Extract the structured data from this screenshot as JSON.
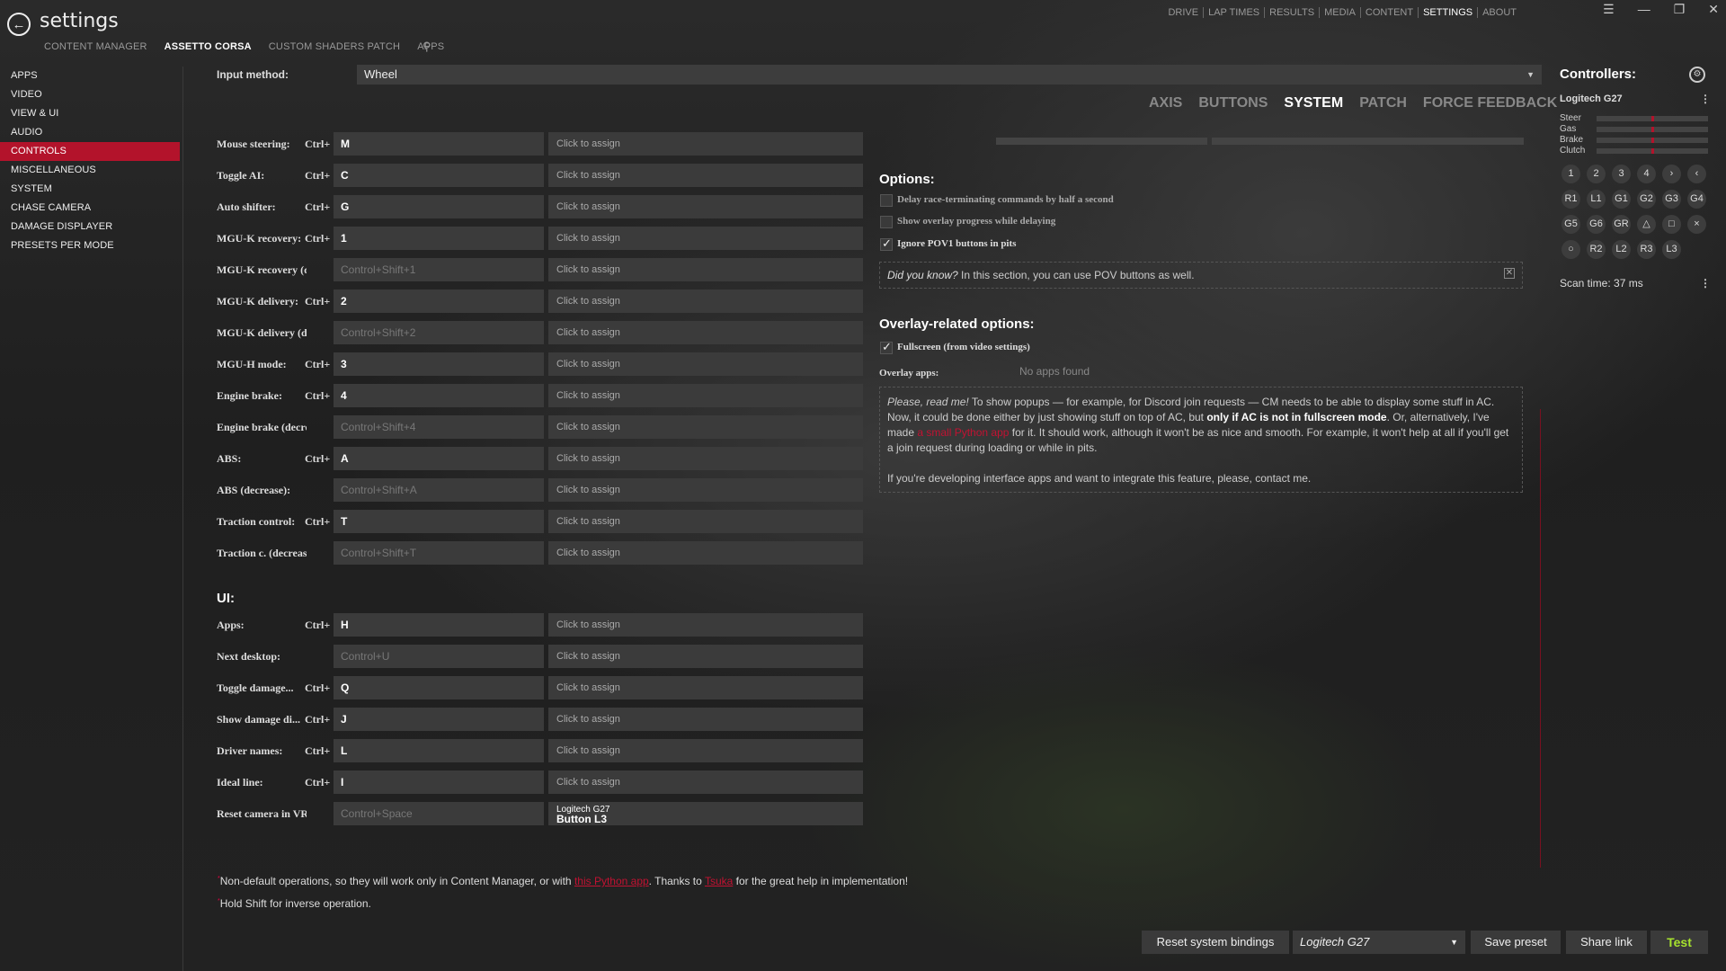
{
  "header": {
    "title": "settings",
    "subtabs": [
      "CONTENT MANAGER",
      "ASSETTO CORSA",
      "CUSTOM SHADERS PATCH",
      "APPS"
    ],
    "main_nav": [
      "DRIVE",
      "LAP TIMES",
      "RESULTS",
      "MEDIA",
      "CONTENT",
      "SETTINGS",
      "ABOUT"
    ]
  },
  "sidebar": {
    "items": [
      "APPS",
      "VIDEO",
      "VIEW & UI",
      "AUDIO",
      "CONTROLS",
      "MISCELLANEOUS",
      "SYSTEM",
      "CHASE CAMERA",
      "DAMAGE DISPLAYER",
      "PRESETS PER MODE"
    ]
  },
  "input": {
    "label": "Input method:",
    "value": "Wheel"
  },
  "tabs": [
    "AXIS",
    "BUTTONS",
    "SYSTEM",
    "PATCH",
    "FORCE FEEDBACK"
  ],
  "bindings": [
    {
      "label": "Mouse steering:",
      "mod": "Ctrl+",
      "key": "M",
      "assign": "Click to assign"
    },
    {
      "label": "Toggle AI:",
      "mod": "Ctrl+",
      "key": "C",
      "assign": "Click to assign"
    },
    {
      "label": "Auto shifter:",
      "mod": "Ctrl+",
      "key": "G",
      "assign": "Click to assign"
    },
    {
      "label": "MGU-K recovery:",
      "mod": "Ctrl+",
      "key": "1",
      "assign": "Click to assign"
    },
    {
      "label": "MGU-K recovery (decrea...",
      "mod": "",
      "key": "Control+Shift+1",
      "assign": "Click to assign"
    },
    {
      "label": "MGU-K delivery:",
      "mod": "Ctrl+",
      "key": "2",
      "assign": "Click to assign"
    },
    {
      "label": "MGU-K delivery (decrea...",
      "mod": "",
      "key": "Control+Shift+2",
      "assign": "Click to assign"
    },
    {
      "label": "MGU-H mode:",
      "mod": "Ctrl+",
      "key": "3",
      "assign": "Click to assign"
    },
    {
      "label": "Engine brake:",
      "mod": "Ctrl+",
      "key": "4",
      "assign": "Click to assign"
    },
    {
      "label": "Engine brake (decrease):",
      "mod": "",
      "key": "Control+Shift+4",
      "assign": "Click to assign"
    },
    {
      "label": "ABS:",
      "mod": "Ctrl+",
      "key": "A",
      "assign": "Click to assign"
    },
    {
      "label": "ABS (decrease):",
      "mod": "",
      "key": "Control+Shift+A",
      "assign": "Click to assign"
    },
    {
      "label": "Traction control:",
      "mod": "Ctrl+",
      "key": "T",
      "assign": "Click to assign"
    },
    {
      "label": "Traction c. (decrease):",
      "mod": "",
      "key": "Control+Shift+T",
      "assign": "Click to assign"
    }
  ],
  "ui_section": "UI:",
  "ui_bindings": [
    {
      "label": "Apps:",
      "mod": "Ctrl+",
      "key": "H",
      "assign": "Click to assign"
    },
    {
      "label": "Next desktop:",
      "mod": "",
      "key": "Control+U",
      "assign": "Click to assign"
    },
    {
      "label": "Toggle damage...",
      "mod": "Ctrl+",
      "key": "Q",
      "assign": "Click to assign"
    },
    {
      "label": "Show damage di...",
      "mod": "Ctrl+",
      "key": "J",
      "assign": "Click to assign"
    },
    {
      "label": "Driver names:",
      "mod": "Ctrl+",
      "key": "L",
      "assign": "Click to assign"
    },
    {
      "label": "Ideal line:",
      "mod": "Ctrl+",
      "key": "I",
      "assign": "Click to assign"
    },
    {
      "label": "Reset camera in VR:",
      "mod": "",
      "key": "Control+Space",
      "assign_device": "Logitech G27",
      "assign_button": "Button L3"
    }
  ],
  "options": {
    "title": "Options:",
    "items": [
      {
        "label": "Delay race-terminating commands by half a second",
        "checked": false
      },
      {
        "label": "Show overlay progress while delaying",
        "checked": false
      },
      {
        "label": "Ignore POV1 buttons in pits",
        "checked": true
      }
    ],
    "tip_italic": "Did you know?",
    "tip_text": " In this section, you can use POV buttons as well."
  },
  "overlay": {
    "title": "Overlay-related options:",
    "fullscreen_label": "Fullscreen (from video settings)",
    "apps_label": "Overlay apps:",
    "apps_value": "No apps found",
    "note_italic": "Please, read me!",
    "note_p1": " To show popups — for example, for Discord join requests — CM needs to be able to display some stuff in AC. Now, it could be done either by just showing stuff on top of AC, but ",
    "note_bold": "only if AC is not in fullscreen mode",
    "note_p2": ". Or, alternatively, I've made ",
    "note_link": "a small Python app",
    "note_p3": " for it. It should work, although it won't be as nice and smooth. For example, it won't help at all if you'll get a join request during loading or while in pits.",
    "note_p4": "If you're developing interface apps and want to integrate this feature, please, contact me."
  },
  "controllers": {
    "title": "Controllers:",
    "device": "Logitech G27",
    "axes": [
      {
        "name": "Steer",
        "value": 0.5
      },
      {
        "name": "Gas",
        "value": 0.5
      },
      {
        "name": "Brake",
        "value": 0.5
      },
      {
        "name": "Clutch",
        "value": 0.5
      }
    ],
    "buttons": [
      "1",
      "2",
      "3",
      "4",
      "›",
      "‹",
      "R1",
      "L1",
      "G1",
      "G2",
      "G3",
      "G4",
      "G5",
      "G6",
      "GR",
      "△",
      "□",
      "×",
      "○",
      "R2",
      "L2",
      "R3",
      "L3"
    ],
    "scan_time": "Scan time: 37 ms"
  },
  "footnotes": {
    "f1_a": "Non-default operations, so they will work only in Content Manager, or with ",
    "f1_link1": "this Python app",
    "f1_b": ". Thanks to ",
    "f1_link2": "Tsuka",
    "f1_c": " for the great help in implementation!",
    "f2": "Hold Shift for inverse operation."
  },
  "footer": {
    "reset": "Reset system bindings",
    "preset_select": "Logitech G27",
    "save": "Save preset",
    "share": "Share link",
    "test": "Test"
  },
  "colors": {
    "accent": "#b3132b",
    "test_green": "#a6e22e"
  }
}
